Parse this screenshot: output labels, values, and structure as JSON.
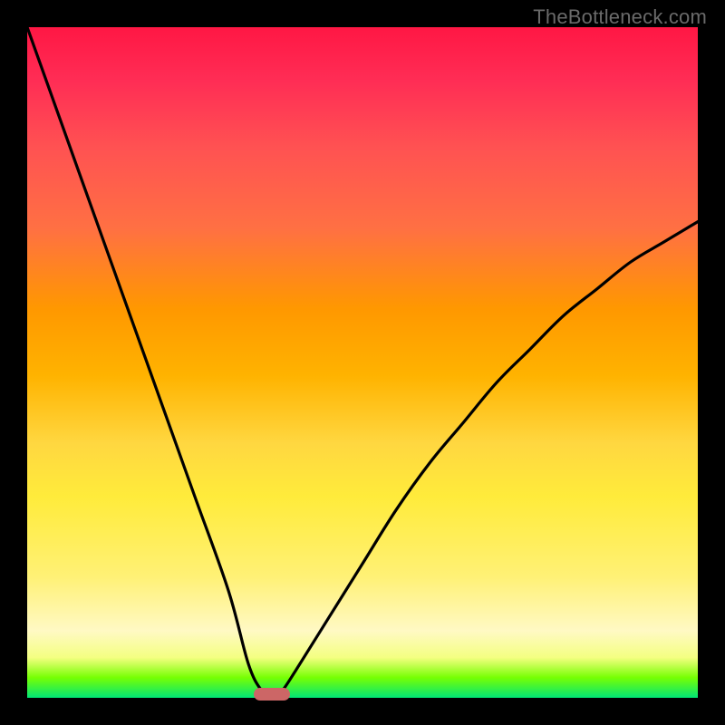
{
  "watermark": "TheBottleneck.com",
  "chart_data": {
    "type": "line",
    "title": "",
    "xlabel": "",
    "ylabel": "",
    "xlim": [
      0,
      100
    ],
    "ylim": [
      0,
      100
    ],
    "grid": false,
    "series": [
      {
        "name": "curve",
        "x": [
          0,
          5,
          10,
          15,
          20,
          25,
          30,
          33,
          35,
          36,
          37,
          38,
          40,
          45,
          50,
          55,
          60,
          65,
          70,
          75,
          80,
          85,
          90,
          95,
          100
        ],
        "values": [
          100,
          86,
          72,
          58,
          44,
          30,
          16,
          5,
          1,
          0.3,
          0.3,
          1,
          4,
          12,
          20,
          28,
          35,
          41,
          47,
          52,
          57,
          61,
          65,
          68,
          71
        ]
      }
    ],
    "marker": {
      "x": 36.5,
      "y": 0.5
    },
    "gradient_stops": [
      {
        "pos": 0,
        "color": "#ff1744"
      },
      {
        "pos": 50,
        "color": "#ffd740"
      },
      {
        "pos": 85,
        "color": "#fff59d"
      },
      {
        "pos": 100,
        "color": "#00e676"
      }
    ]
  }
}
